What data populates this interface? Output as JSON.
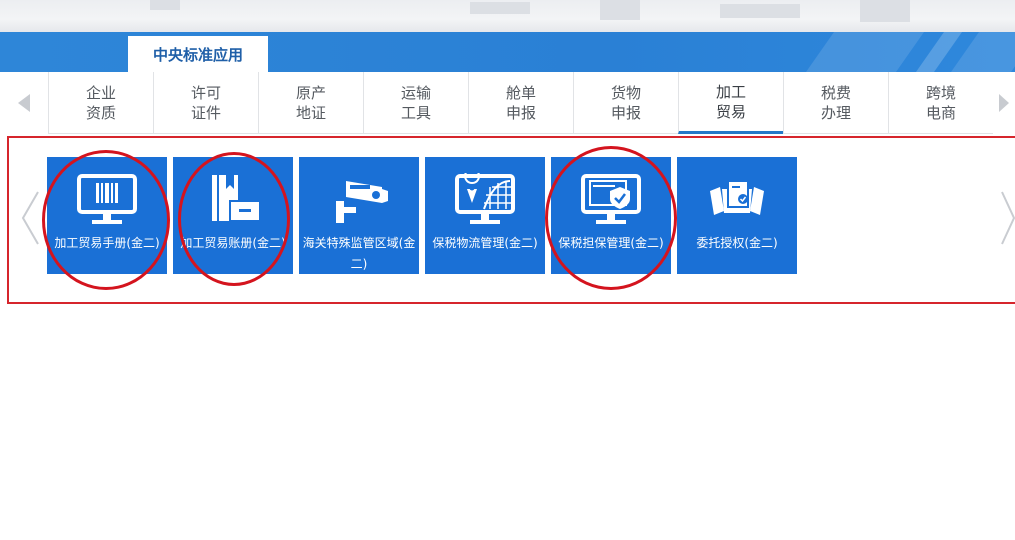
{
  "active_tab": {
    "label": "中央标准应用"
  },
  "categories": [
    {
      "label": "企业\n资质",
      "active": false
    },
    {
      "label": "许可\n证件",
      "active": false
    },
    {
      "label": "原产\n地证",
      "active": false
    },
    {
      "label": "运输\n工具",
      "active": false
    },
    {
      "label": "舱单\n申报",
      "active": false
    },
    {
      "label": "货物\n申报",
      "active": false
    },
    {
      "label": "加工\n贸易",
      "active": true
    },
    {
      "label": "税费\n办理",
      "active": false
    },
    {
      "label": "跨境\n电商",
      "active": false
    }
  ],
  "tiles": [
    {
      "label": "加工贸易手册(金二)",
      "icon": "monitor-barcode-icon",
      "highlighted": true
    },
    {
      "label": "加工贸易账册(金二)",
      "icon": "ledger-box-icon",
      "highlighted": true
    },
    {
      "label": "海关特殊监管区域(金二)",
      "icon": "surveillance-camera-icon",
      "highlighted": false
    },
    {
      "label": "保税物流管理(金二)",
      "icon": "monitor-location-globe-icon",
      "highlighted": false
    },
    {
      "label": "保税担保管理(金二)",
      "icon": "monitor-shield-icon",
      "highlighted": true
    },
    {
      "label": "委托授权(金二)",
      "icon": "handshake-document-icon",
      "highlighted": false
    }
  ],
  "colors": {
    "brand_blue": "#2e86d8",
    "tile_blue": "#1a70d6",
    "highlight_red": "#d4141e",
    "frame_red": "#d6252c"
  }
}
